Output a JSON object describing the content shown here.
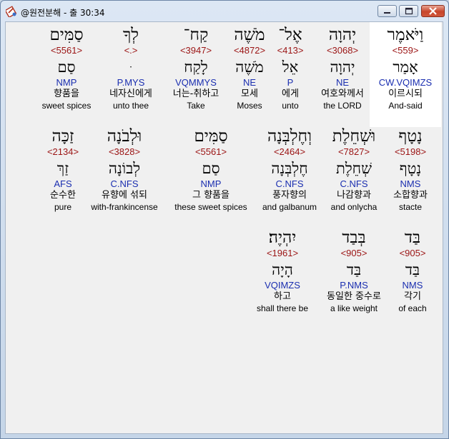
{
  "window": {
    "title": "@원전분해 - 출 30:34",
    "minimize_symbol": "—",
    "maximize_symbol": "▭",
    "close_symbol": "✕"
  },
  "words": [
    {
      "heb": "וַיֹּאמֶר",
      "strong": "<559>",
      "lemma": "אָמַר",
      "morph": "CW.VQIMZS",
      "ko": "이르시되",
      "en": "And-said",
      "selected": true
    },
    {
      "heb": "יְהוָה",
      "strong": "<3068>",
      "lemma": "יְהוָה",
      "morph": "NE",
      "ko": "여호와께서",
      "en": "the LORD"
    },
    {
      "heb": "אֶל־",
      "strong": "<413>",
      "lemma": "אֵל",
      "morph": "P",
      "ko": "에게",
      "en": "unto"
    },
    {
      "heb": "מֹשֶׁה",
      "strong": "<4872>",
      "lemma": "מֹשֶׁה",
      "morph": "NE",
      "ko": "모세",
      "en": "Moses"
    },
    {
      "heb": "קַח־",
      "strong": "<3947>",
      "lemma": "לָקַח",
      "morph": "VQMMYS",
      "ko": "너는-취하고",
      "en": "Take"
    },
    {
      "heb": "לְךָ",
      "strong": "<.>",
      "lemma": "ּ",
      "morph": "P.MYS",
      "ko": "네자신에게",
      "en": "unto thee"
    },
    {
      "heb": "סַמִּים",
      "strong": "<5561>",
      "lemma": "סַם",
      "morph": "NMP",
      "ko": "향품을",
      "en": "sweet spices"
    },
    {
      "heb": "נָטָף",
      "strong": "<5198>",
      "lemma": "נָטָף",
      "morph": "NMS",
      "ko": "소합향과",
      "en": "stacte"
    },
    {
      "heb": "וּשְׁחֵלֶת",
      "strong": "<7827>",
      "lemma": "שְׁחֵלֶת",
      "morph": "C.NFS",
      "ko": "나감향과",
      "en": "and onlycha"
    },
    {
      "heb": "וְחֶלְבְּנָה",
      "strong": "<2464>",
      "lemma": "חֶלְבְּנָה",
      "morph": "C.NFS",
      "ko": "풍자향의",
      "en": "and galbanum"
    },
    {
      "heb": "סַמִּים",
      "strong": "<5561>",
      "lemma": "סַם",
      "morph": "NMP",
      "ko": "그 향품을",
      "en": "these sweet spices"
    },
    {
      "heb": "וּלְבֹנָה",
      "strong": "<3828>",
      "lemma": "לְבוֹנָה",
      "morph": "C.NFS",
      "ko": "유향에 섞되",
      "en": "with-frankincense"
    },
    {
      "heb": "זַכָּה",
      "strong": "<2134>",
      "lemma": "זַךְ",
      "morph": "AFS",
      "ko": "순수한",
      "en": "pure"
    },
    {
      "heb": "בַּד",
      "strong": "<905>",
      "lemma": "בַּד",
      "morph": "NMS",
      "ko": "각기",
      "en": "of each"
    },
    {
      "heb": "בְּבַד",
      "strong": "<905>",
      "lemma": "בַּד",
      "morph": "P.NMS",
      "ko": "동일한 중수로",
      "en": "a like weight"
    },
    {
      "heb": "יִהְיֶה׃",
      "strong": "<1961>",
      "lemma": "הָיָה",
      "morph": "VQIMZS",
      "ko": "하고",
      "en": "shall there be"
    }
  ]
}
